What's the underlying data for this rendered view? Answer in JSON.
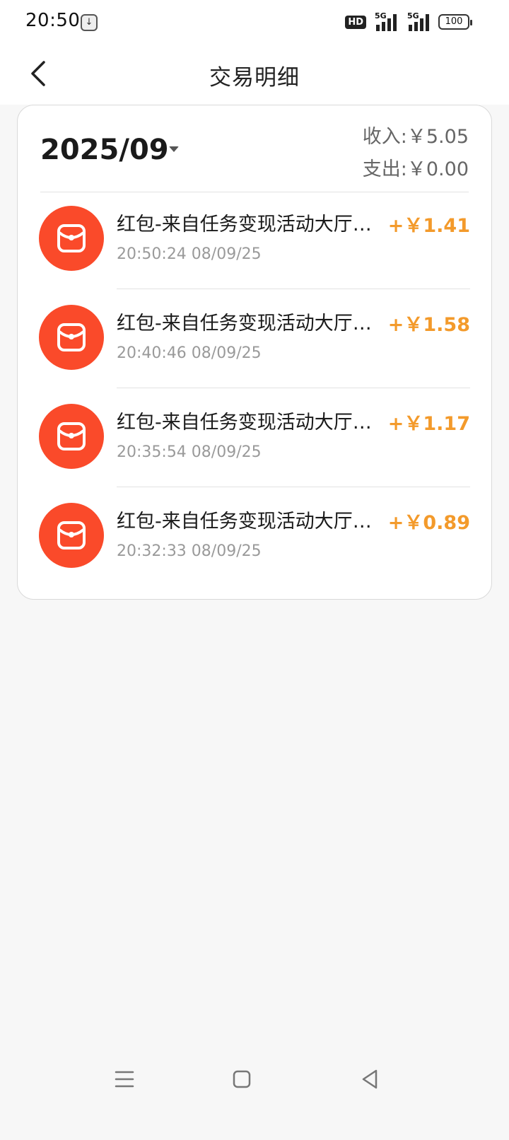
{
  "status_bar": {
    "time": "20:50",
    "app_icon_glyph": "↓",
    "hd_label": "HD",
    "signal1_label": "5G",
    "signal2_label": "5G",
    "battery": "100"
  },
  "header": {
    "title": "交易明细"
  },
  "summary": {
    "month": "2025/09",
    "income_label": "收入:",
    "income_value": "￥5.05",
    "expense_label": "支出:",
    "expense_value": "￥0.00"
  },
  "transactions": [
    {
      "title": "红包-来自任务变现活动大厅…",
      "time": "20:50:24 08/09/25",
      "amount": "+￥1.41"
    },
    {
      "title": "红包-来自任务变现活动大厅…",
      "time": "20:40:46 08/09/25",
      "amount": "+￥1.58"
    },
    {
      "title": "红包-来自任务变现活动大厅…",
      "time": "20:35:54 08/09/25",
      "amount": "+￥1.17"
    },
    {
      "title": "红包-来自任务变现活动大厅…",
      "time": "20:32:33 08/09/25",
      "amount": "+￥0.89"
    }
  ],
  "colors": {
    "accent_amount": "#f39a2b",
    "red_packet": "#fa4a2a"
  }
}
